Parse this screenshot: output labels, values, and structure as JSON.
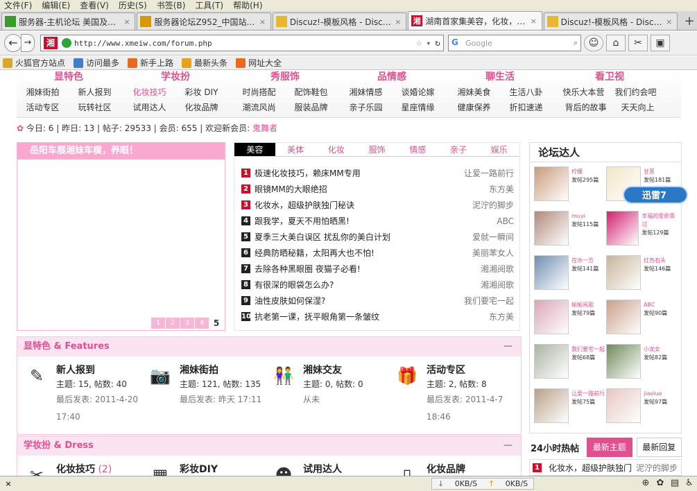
{
  "menu": [
    "文件(F)",
    "编辑(E)",
    "查看(V)",
    "历史(S)",
    "书签(B)",
    "工具(T)",
    "帮助(H)"
  ],
  "tabs": [
    {
      "title": "服务器-主机论坛 美国及…",
      "icon": "green-s-icon",
      "color": "#3a9a2a"
    },
    {
      "title": "服务器论坛Z952_中国站长…",
      "icon": "chart-icon",
      "color": "#d49a00"
    },
    {
      "title": "Discuz!-模板风格 - Disc…",
      "icon": "discuz-icon",
      "color": "#e8b730"
    },
    {
      "title": "湖南首家集美容，化妆，…",
      "icon": "xiang-icon",
      "color": "#c8102e"
    },
    {
      "title": "Discuz!-模板风格 - Disc…",
      "icon": "discuz-icon",
      "color": "#e8b730"
    }
  ],
  "address": "http://www.xmeiw.com/forum.php",
  "search_placeholder": "Google",
  "bookmarks": [
    "火狐官方站点",
    "访问最多",
    "新手上路",
    "最新头条",
    "网址大全"
  ],
  "site_icon_text": "湘",
  "nav": [
    {
      "head": "显特色",
      "items": [
        [
          "湘妹街拍",
          "新人报到"
        ],
        [
          "活动专区",
          "玩转社区"
        ]
      ]
    },
    {
      "head": "学妆扮",
      "items": [
        [
          "化妆技巧",
          "彩妆 DIY"
        ],
        [
          "试用达人",
          "化妆品牌"
        ]
      ]
    },
    {
      "head": "秀服饰",
      "items": [
        [
          "时尚搭配",
          "配饰鞋包"
        ],
        [
          "潮流风尚",
          "服装品牌"
        ]
      ]
    },
    {
      "head": "品情感",
      "items": [
        [
          "湘妹情感",
          "谈婚论嫁"
        ],
        [
          "亲子乐园",
          "星座情缘"
        ]
      ]
    },
    {
      "head": "聊生活",
      "items": [
        [
          "湘妹美食",
          "生活八卦"
        ],
        [
          "健康保养",
          "折扣速递"
        ]
      ]
    },
    {
      "head": "看卫视",
      "items": [
        [
          "快乐大本营",
          "我们约会吧"
        ],
        [
          "背后的故事",
          "天天向上"
        ]
      ]
    }
  ],
  "stats": {
    "today_label": "今日:",
    "today": "6",
    "yesterday_label": "昨日:",
    "yesterday": "13",
    "posts_label": "帖子:",
    "posts": "29533",
    "members_label": "会员:",
    "members": "655",
    "welcome": "欢迎新会员:",
    "newest": "鬼舞者"
  },
  "slide": {
    "title": "岳阳车展湘妹车模，养眼！",
    "pages": [
      "1",
      "2",
      "3",
      "4",
      "5"
    ]
  },
  "hot": {
    "tabs": [
      "美容",
      "美体",
      "化妆",
      "服饰",
      "情感",
      "亲子",
      "娱乐"
    ],
    "items": [
      {
        "n": "1",
        "title": "极速化妆技巧，赖床MM专用",
        "author": "让爱一路前行"
      },
      {
        "n": "2",
        "title": "眼镜MM的大眼绝招",
        "author": "东方美"
      },
      {
        "n": "3",
        "title": "化妆水，超级护肤独门秘诀",
        "author": "泥泞的脚步"
      },
      {
        "n": "4",
        "title": "跟我学，夏天不用怕晒黑!",
        "author": "ABC"
      },
      {
        "n": "5",
        "title": "夏季三大美白误区 扰乱你的美白计划",
        "author": "爱就一瞬间"
      },
      {
        "n": "6",
        "title": "经典防晒秘籍，太阳再大也不怕!",
        "author": "美丽苯女人"
      },
      {
        "n": "7",
        "title": "去除各种黑眼圈 夜猫子必看!",
        "author": "湘湘阅歌"
      },
      {
        "n": "8",
        "title": "有很深的眼袋怎么办?",
        "author": "湘湘阅歌"
      },
      {
        "n": "9",
        "title": "油性皮肤如何保湿?",
        "author": "我们要宅一起"
      },
      {
        "n": "10",
        "title": "抗老第一课，抚平眼角第一条皱纹",
        "author": "东方美"
      }
    ]
  },
  "talent": {
    "title": "论坛达人",
    "users": [
      {
        "name": "柠檬",
        "count": "发帖295篇",
        "color": "#c99a7a"
      },
      {
        "name": "甘蔗",
        "count": "发帖181篇",
        "color": "#f3e6c8"
      },
      {
        "name": "muyi",
        "count": "发帖115篇",
        "color": "#b08a7c"
      },
      {
        "name": "幸福的爱依靠过",
        "count": "发帖129篇",
        "color": "#d02070"
      },
      {
        "name": "在水一方",
        "count": "发帖141篇",
        "color": "#6f8fb0"
      },
      {
        "name": "红色石头",
        "count": "发帖146篇",
        "color": "#c8b59a"
      },
      {
        "name": "瑜瑜阅歌",
        "count": "发帖79篇",
        "color": "#d9a7b7"
      },
      {
        "name": "ABC",
        "count": "发帖90篇",
        "color": "#c9a08a"
      },
      {
        "name": "我们要宅一起",
        "count": "发帖68篇",
        "color": "#a9b4a4"
      },
      {
        "name": "小龙女",
        "count": "发帖82篇",
        "color": "#6f8a5a"
      },
      {
        "name": "让爱一路前行",
        "count": "发帖75篇",
        "color": "#b8a08a"
      },
      {
        "name": "jiaoluo",
        "count": "发帖97篇",
        "color": "#e7c7c0"
      }
    ]
  },
  "xunlei": "迅雷7",
  "sections": [
    {
      "title": "显特色 & Features",
      "forums": [
        {
          "name": "新人报到",
          "count": "",
          "meta": "主题: 15, 帖数: 40",
          "last": "最后发表: 2011-4-20 17:40",
          "icon": "pencil-icon",
          "glyph": "✎"
        },
        {
          "name": "湘妹街拍",
          "count": "",
          "meta": "主题: 121, 帖数: 135",
          "last": "最后发表: 昨天 17:11",
          "icon": "camera-icon",
          "glyph": "📷"
        },
        {
          "name": "湘妹交友",
          "count": "",
          "meta": "主题: 0, 帖数: 0",
          "last": "从未",
          "icon": "couple-icon",
          "glyph": "👫"
        },
        {
          "name": "活动专区",
          "count": "",
          "meta": "主题: 2, 帖数: 8",
          "last": "最后发表: 2011-4-7 18:46",
          "icon": "gift-icon",
          "glyph": "🎁"
        }
      ]
    },
    {
      "title": "学妆扮 & Dress",
      "forums": [
        {
          "name": "化妆技巧",
          "count": "(2)",
          "meta": "",
          "last": "",
          "icon": "brush-icon",
          "glyph": "✂"
        },
        {
          "name": "彩妆DIY",
          "count": "",
          "meta": "",
          "last": "",
          "icon": "palette-icon",
          "glyph": "▦"
        },
        {
          "name": "试用达人",
          "count": "",
          "meta": "",
          "last": "",
          "icon": "person-icon",
          "glyph": "☻"
        },
        {
          "name": "化妆品牌",
          "count": "",
          "meta": "",
          "last": "",
          "icon": "bottle-icon",
          "glyph": "▯"
        }
      ]
    }
  ],
  "hot24": {
    "title": "24小时热帖",
    "btn_new": "最新主题",
    "btn_reply": "最新回复",
    "item": {
      "n": "1",
      "title": "化妆水，超级护肤独门",
      "author": "泥泞的脚步"
    }
  },
  "status": {
    "down": "0KB/S",
    "up": "0KB/S"
  }
}
